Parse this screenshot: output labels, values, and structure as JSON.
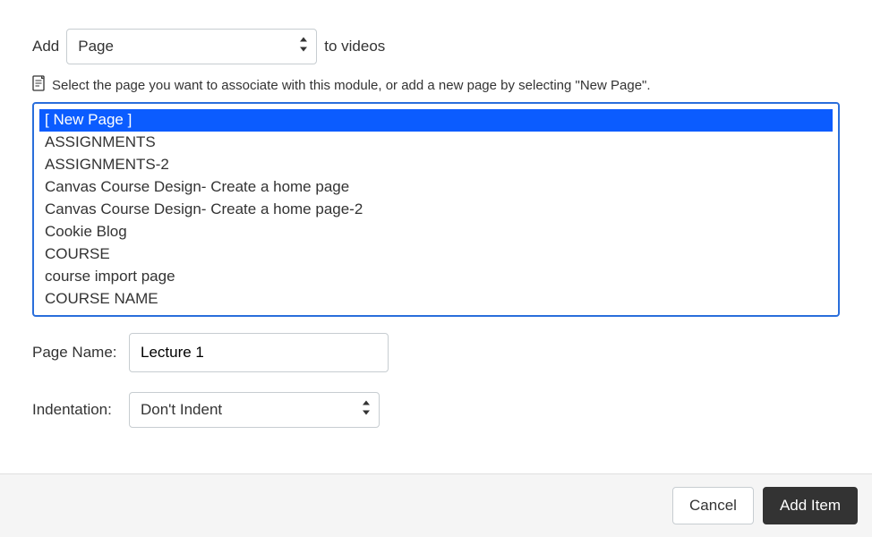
{
  "addRow": {
    "prefix": "Add",
    "typeSelected": "Page",
    "suffix": "to videos"
  },
  "instruction": "Select the page you want to associate with this module, or add a new page by selecting \"New Page\".",
  "items": [
    "[ New Page ]",
    "ASSIGNMENTS",
    "ASSIGNMENTS-2",
    "Canvas Course Design- Create a home page",
    "Canvas Course Design- Create a home page-2",
    "Cookie Blog",
    "COURSE",
    "course import page",
    "COURSE NAME"
  ],
  "selectedIndex": 0,
  "pageName": {
    "label": "Page Name:",
    "value": "Lecture 1"
  },
  "indentation": {
    "label": "Indentation:",
    "selected": "Don't Indent"
  },
  "footer": {
    "cancel": "Cancel",
    "addItem": "Add Item"
  }
}
